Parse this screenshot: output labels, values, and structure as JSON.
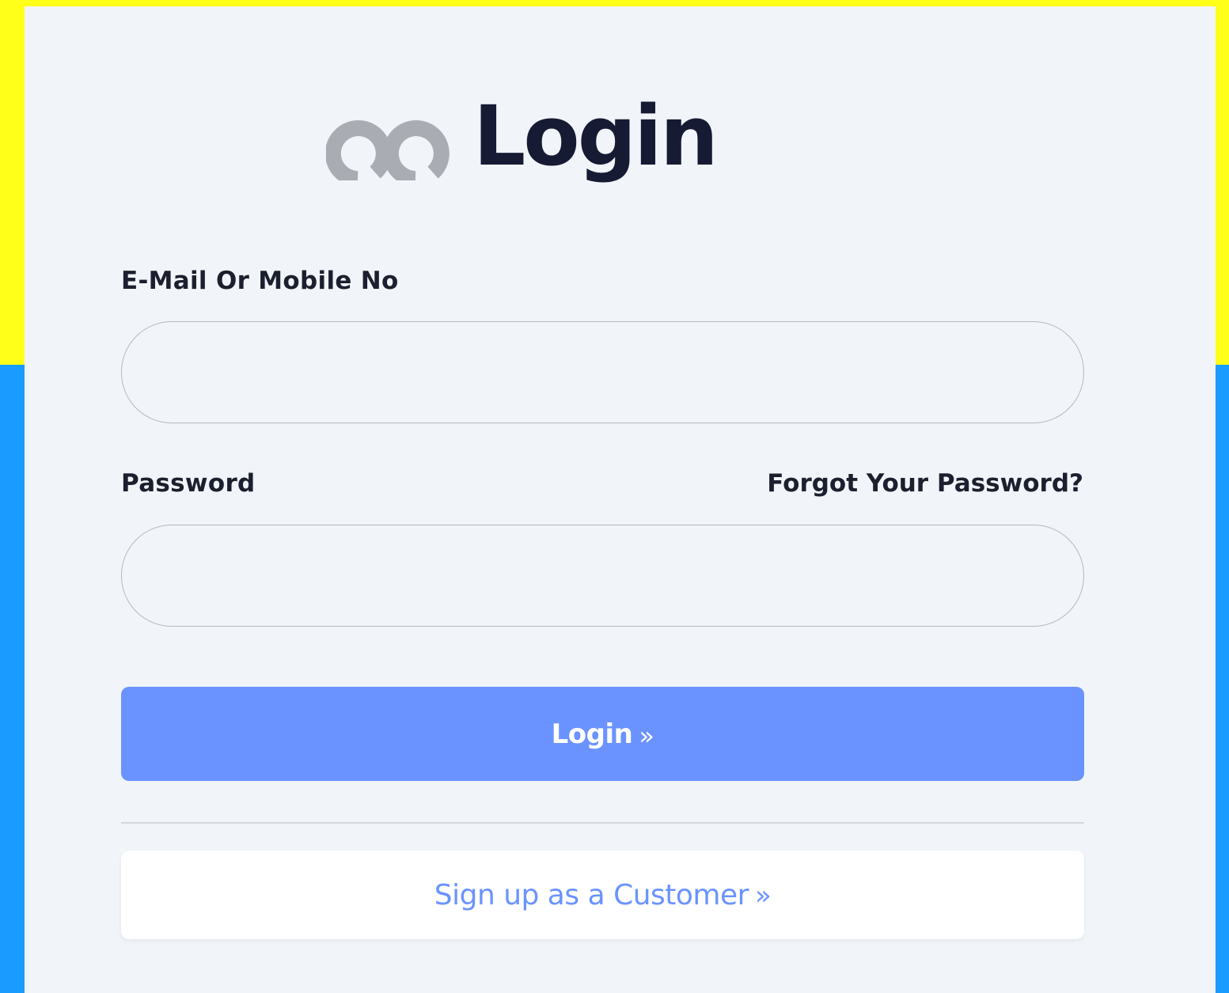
{
  "colors": {
    "background_top": "#ffff1a",
    "background_bottom": "#1a9bff",
    "card_background": "#f1f5f9",
    "title_text": "#161a33",
    "logo_gray": "#a9adb3",
    "label_text": "#1c1f2e",
    "login_button": "#6a93ff",
    "signup_text": "#6a93ff"
  },
  "header": {
    "logo_icon": "double-q-logo-icon",
    "title": "Login"
  },
  "form": {
    "email": {
      "label": "E-Mail Or Mobile No",
      "value": "",
      "placeholder": ""
    },
    "password": {
      "label": "Password",
      "value": "",
      "placeholder": ""
    },
    "forgot_password_link": "Forgot Your Password?",
    "login_button": {
      "label": "Login",
      "icon": "»"
    }
  },
  "signup": {
    "label": "Sign up as a Customer",
    "icon": "»"
  }
}
